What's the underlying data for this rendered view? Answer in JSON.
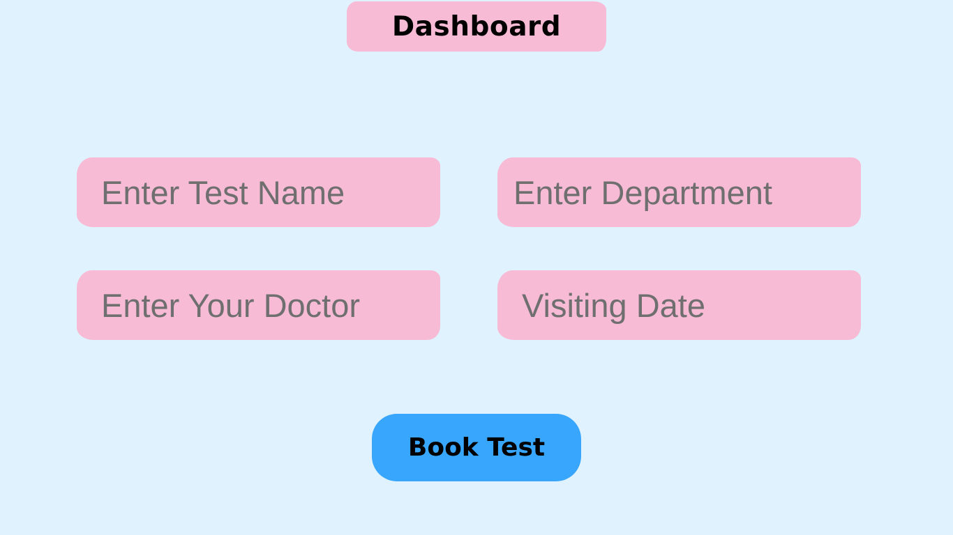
{
  "header": {
    "title": "Dashboard"
  },
  "form": {
    "fields": [
      {
        "placeholder": "Enter Test Name",
        "value": ""
      },
      {
        "placeholder": "Enter Department",
        "value": ""
      },
      {
        "placeholder": "Enter Your Doctor",
        "value": ""
      },
      {
        "placeholder": "Visiting Date",
        "value": ""
      }
    ],
    "submit_label": "Book Test"
  },
  "colors": {
    "background": "#dff2fe",
    "pill": "#f7bbd6",
    "button": "#38a6fd",
    "placeholder_text": "#6f6f6f"
  }
}
